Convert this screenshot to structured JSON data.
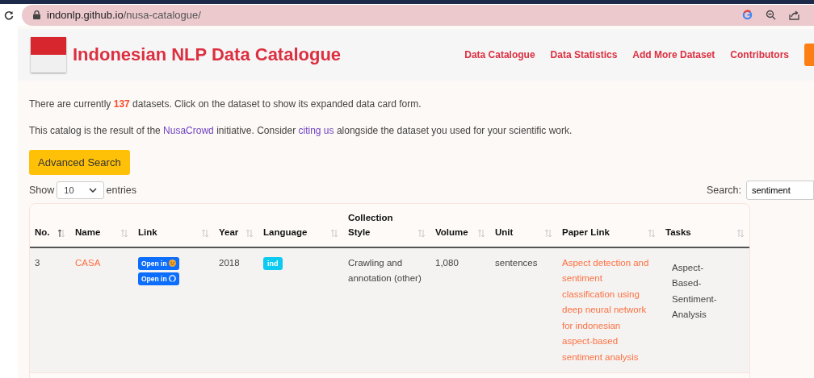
{
  "browser": {
    "url_host": "indonlp.github.io",
    "url_path": "/nusa-catalogue/"
  },
  "header": {
    "title": "Indonesian NLP Data Catalogue",
    "nav": [
      {
        "label": "Data Catalogue"
      },
      {
        "label": "Data Statistics"
      },
      {
        "label": "Add More Dataset"
      },
      {
        "label": "Contributors"
      }
    ]
  },
  "intro": [
    [
      {
        "kind": "plain",
        "text": "There are currently "
      },
      {
        "kind": "count",
        "text": "137"
      },
      {
        "kind": "plain",
        "text": " datasets. Click on the dataset to show its expanded data card form."
      }
    ],
    [
      {
        "kind": "plain",
        "text": "This catalog is the result of the "
      },
      {
        "kind": "link",
        "text": "NusaCrowd"
      },
      {
        "kind": "plain",
        "text": " initiative. Consider "
      },
      {
        "kind": "link",
        "text": "citing us"
      },
      {
        "kind": "plain",
        "text": " alongside the dataset you used for your scientific work."
      }
    ]
  ],
  "advanced_search": "Advanced Search",
  "length": {
    "prefix": "Show",
    "value": "10",
    "suffix": "entries"
  },
  "search": {
    "label": "Search:",
    "value": "sentiment"
  },
  "table": {
    "columns": [
      {
        "label": "No.",
        "sorted": true
      },
      {
        "label": "Name",
        "sorted": false
      },
      {
        "label": "Link",
        "sorted": false
      },
      {
        "label": "Year",
        "sorted": false
      },
      {
        "label": "Language",
        "sorted": false
      },
      {
        "label": "Collection Style",
        "sorted": false
      },
      {
        "label": "Volume",
        "sorted": false
      },
      {
        "label": "Unit",
        "sorted": false
      },
      {
        "label": "Paper Link",
        "sorted": false
      },
      {
        "label": "Tasks",
        "sorted": false
      }
    ],
    "rows": [
      {
        "no": "3",
        "name": "CASA",
        "links": [
          {
            "label": "Open in",
            "kind": "huggingface"
          },
          {
            "label": "Open in",
            "kind": "github"
          }
        ],
        "year": "2018",
        "language": "ind",
        "collection_style": "Crawling and annotation (other)",
        "volume": "1,080",
        "unit": "sentences",
        "paper_link": "Aspect detection and sentiment classification using deep neural network for indonesian aspect-based sentiment analysis",
        "tasks": "Aspect-Based-Sentiment-Analysis"
      }
    ]
  }
}
